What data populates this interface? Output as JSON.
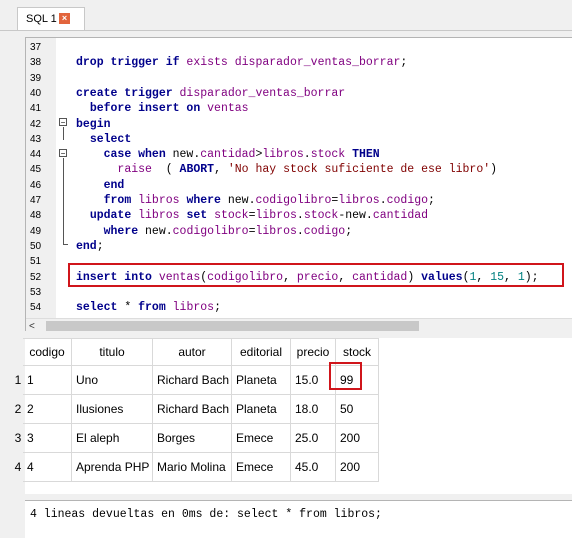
{
  "tab": {
    "label": "SQL 1",
    "close_icon": "×"
  },
  "editor": {
    "lines": [
      {
        "n": "37",
        "tokens": []
      },
      {
        "n": "38",
        "tokens": [
          [
            "kw",
            "drop trigger if "
          ],
          [
            "id",
            "exists"
          ],
          [
            "kw",
            " "
          ],
          [
            "id",
            "disparador_ventas_borrar"
          ],
          [
            "",
            ";"
          ]
        ]
      },
      {
        "n": "39",
        "tokens": []
      },
      {
        "n": "40",
        "tokens": [
          [
            "kw",
            "create trigger "
          ],
          [
            "id",
            "disparador_ventas_borrar"
          ]
        ]
      },
      {
        "n": "41",
        "tokens": [
          [
            "",
            "  "
          ],
          [
            "kw",
            "before insert on "
          ],
          [
            "id",
            "ventas"
          ]
        ]
      },
      {
        "n": "42",
        "tokens": [
          [
            "kw",
            "begin"
          ]
        ]
      },
      {
        "n": "43",
        "tokens": [
          [
            "",
            "  "
          ],
          [
            "kw",
            "select"
          ]
        ]
      },
      {
        "n": "44",
        "tokens": [
          [
            "",
            "    "
          ],
          [
            "kw",
            "case when "
          ],
          [
            "",
            "new."
          ],
          [
            "id",
            "cantidad"
          ],
          [
            "",
            ">"
          ],
          [
            "id",
            "libros"
          ],
          [
            "",
            "."
          ],
          [
            "id",
            "stock"
          ],
          [
            "kw",
            " THEN"
          ]
        ]
      },
      {
        "n": "45",
        "tokens": [
          [
            "",
            "      "
          ],
          [
            "id",
            "raise"
          ],
          [
            "",
            "  ( "
          ],
          [
            "kw",
            "ABORT"
          ],
          [
            "",
            ", "
          ],
          [
            "str",
            "'No hay stock suficiente de ese libro'"
          ],
          [
            "",
            ")"
          ]
        ]
      },
      {
        "n": "46",
        "tokens": [
          [
            "",
            "    "
          ],
          [
            "kw",
            "end"
          ]
        ]
      },
      {
        "n": "47",
        "tokens": [
          [
            "",
            "    "
          ],
          [
            "kw",
            "from "
          ],
          [
            "id",
            "libros"
          ],
          [
            "kw",
            " where "
          ],
          [
            "",
            "new."
          ],
          [
            "id",
            "codigolibro"
          ],
          [
            "",
            "="
          ],
          [
            "id",
            "libros"
          ],
          [
            "",
            "."
          ],
          [
            "id",
            "codigo"
          ],
          [
            "",
            ";"
          ]
        ]
      },
      {
        "n": "48",
        "tokens": [
          [
            "",
            "  "
          ],
          [
            "kw",
            "update "
          ],
          [
            "id",
            "libros"
          ],
          [
            "kw",
            " set "
          ],
          [
            "id",
            "stock"
          ],
          [
            "",
            "="
          ],
          [
            "id",
            "libros"
          ],
          [
            "",
            "."
          ],
          [
            "id",
            "stock"
          ],
          [
            "",
            "-new."
          ],
          [
            "id",
            "cantidad"
          ]
        ]
      },
      {
        "n": "49",
        "tokens": [
          [
            "",
            "    "
          ],
          [
            "kw",
            "where "
          ],
          [
            "",
            "new."
          ],
          [
            "id",
            "codigolibro"
          ],
          [
            "",
            "="
          ],
          [
            "id",
            "libros"
          ],
          [
            "",
            "."
          ],
          [
            "id",
            "codigo"
          ],
          [
            "",
            ";"
          ]
        ]
      },
      {
        "n": "50",
        "tokens": [
          [
            "kw",
            "end"
          ],
          [
            "",
            ";"
          ]
        ]
      },
      {
        "n": "51",
        "tokens": []
      },
      {
        "n": "52",
        "tokens": [
          [
            "kw",
            "insert into "
          ],
          [
            "id",
            "ventas"
          ],
          [
            "",
            "("
          ],
          [
            "id",
            "codigolibro"
          ],
          [
            "",
            ", "
          ],
          [
            "id",
            "precio"
          ],
          [
            "",
            ", "
          ],
          [
            "id",
            "cantidad"
          ],
          [
            "",
            ") "
          ],
          [
            "kw",
            "values"
          ],
          [
            "",
            "("
          ],
          [
            "num",
            "1"
          ],
          [
            "",
            ", "
          ],
          [
            "num",
            "15"
          ],
          [
            "",
            ", "
          ],
          [
            "num",
            "1"
          ],
          [
            "",
            ");"
          ]
        ]
      },
      {
        "n": "53",
        "tokens": []
      },
      {
        "n": "54",
        "tokens": [
          [
            "kw",
            "select "
          ],
          [
            "",
            "* "
          ],
          [
            "kw",
            "from "
          ],
          [
            "id",
            "libros"
          ],
          [
            "",
            ";"
          ]
        ]
      }
    ],
    "scroll_left_icon": "<"
  },
  "results": {
    "columns": [
      "codigo",
      "titulo",
      "autor",
      "editorial",
      "precio",
      "stock"
    ],
    "rows": [
      {
        "n": "1",
        "cells": [
          "1",
          "Uno",
          "Richard Bach",
          "Planeta",
          "15.0",
          "99"
        ]
      },
      {
        "n": "2",
        "cells": [
          "2",
          "Ilusiones",
          "Richard Bach",
          "Planeta",
          "18.0",
          "50"
        ]
      },
      {
        "n": "3",
        "cells": [
          "3",
          "El aleph",
          "Borges",
          "Emece",
          "25.0",
          "200"
        ]
      },
      {
        "n": "4",
        "cells": [
          "4",
          "Aprenda PHP",
          "Mario Molina",
          "Emece",
          "45.0",
          "200"
        ]
      }
    ]
  },
  "status": {
    "message": "4 lineas devueltas en 0ms de: select * from libros;"
  }
}
